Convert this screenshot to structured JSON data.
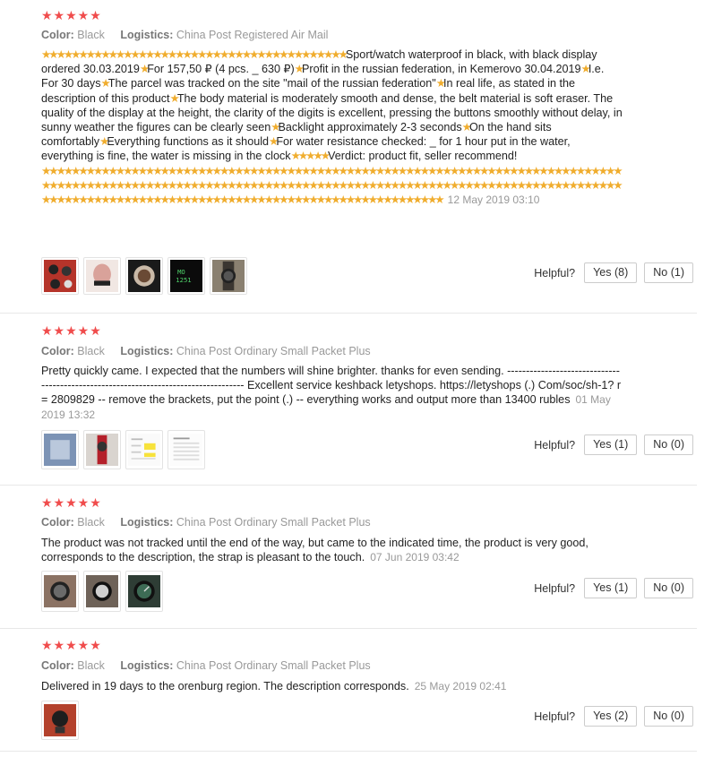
{
  "labels": {
    "color": "Color:",
    "logistics": "Logistics:",
    "helpful": "Helpful?"
  },
  "reviews": [
    {
      "rating": "★★★★★",
      "color": "Black",
      "logistics": "China Post Registered Air Mail",
      "text": "★★★★★★★★★★★★★★★★★★★★★★★★★★★★★★★★★★★★★★★★★Sport/watch waterproof in black, with black display ordered 30.03.2019★For 157,50 ₽ (4 pcs. _ 630 ₽)★Profit in the russian federation, in Kemerovo 30.04.2019★I.e. For 30 days★The parcel was tracked on the site \"mail of the russian federation\"★In real life, as stated in the description of this product★The body material is moderately smooth and dense, the belt material is soft eraser. The quality of the display at the height, the clarity of the digits is excellent, pressing the buttons smoothly without delay, in sunny weather the figures can be clearly seen★Backlight approximately 2-3 seconds★On the hand sits comfortably★Everything functions as it should★For water resistance checked: _ for 1 hour put in the water, everything is fine, the water is missing in the clock★★★★★Verdict: product fit, seller recommend!★★★★★★★★★★★★★★★★★★★★★★★★★★★★★★★★★★★★★★★★★★★★★★★★★★★★★★★★★★★★★★★★★★★★★★★★★★★★★★★★★★★★★★★★★★★★★★★★★★★★★★★★★★★★★★★★★★★★★★★★★★★★★★★★★★★★★★★★★★★★★★★★★★★★★★★★★★★★★★★★★★★★★★★★★★★★★★★★★★★★★★★★★★★★★★★★★★★★★★★★★★★★★★★★★★",
      "date": "12 May 2019 03:10",
      "yes": "Yes (8)",
      "no": "No (1)"
    },
    {
      "rating": "★★★★★",
      "color": "Black",
      "logistics": "China Post Ordinary Small Packet Plus",
      "text": "Pretty quickly came. I expected that the numbers will shine brighter. thanks for even sending. ------------------------------------------------------------------------------------ Excellent service keshback letyshops. https://letyshops (.) Com/soc/sh-1? r = 2809829 -- remove the brackets, put the point (.) -- everything works and output more than 13400 rubles",
      "date": "01 May 2019 13:32",
      "yes": "Yes (1)",
      "no": "No (0)"
    },
    {
      "rating": "★★★★★",
      "color": "Black",
      "logistics": "China Post Ordinary Small Packet Plus",
      "text": "The product was not tracked until the end of the way, but came to the indicated time, the product is very good, corresponds to the description, the strap is pleasant to the touch.",
      "date": "07 Jun 2019 03:42",
      "yes": "Yes (1)",
      "no": "No (0)"
    },
    {
      "rating": "★★★★★",
      "color": "Black",
      "logistics": "China Post Ordinary Small Packet Plus",
      "text": "Delivered in 19 days to the orenburg region. The description corresponds.",
      "date": "25 May 2019 02:41",
      "yes": "Yes (2)",
      "no": "No (0)"
    }
  ]
}
